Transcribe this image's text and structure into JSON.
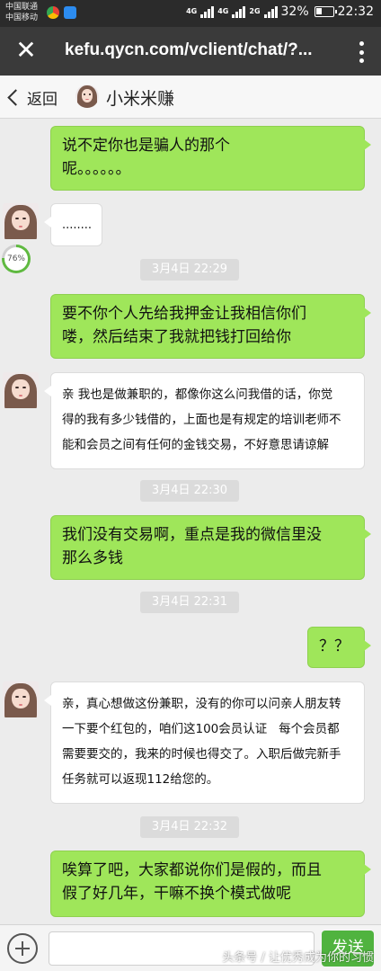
{
  "status_bar": {
    "carrier_1": "中国联通",
    "carrier_2": "中国移动",
    "net_4g": "4G",
    "net_4g_small": "4G",
    "net_2g": "2G",
    "battery": "32%",
    "time": "22:32"
  },
  "browser": {
    "url": "kefu.qycn.com/vclient/chat/?..."
  },
  "chat_header": {
    "back_label": "返回",
    "title": "小米米赚"
  },
  "messages": {
    "m1": "说不定你也是骗人的那个\n呢。。。。。。",
    "m2": "........",
    "progress_text": "76%",
    "progress_value": 0.76,
    "ts1": "3月4日 22:29",
    "m3": "要不你个人先给我押金让我相信你们\n喽，然后结束了我就把钱打回给你",
    "m4": "亲 我也是做兼职的，都像你这么问我借的话，你觉\n得的我有多少钱借的，上面也是有规定的培训老师不\n能和会员之间有任何的金钱交易，不好意思请谅解",
    "ts2": "3月4日 22:30",
    "m5": "我们没有交易啊，重点是我的微信里没\n那么多钱",
    "ts3": "3月4日 22:31",
    "m6": "？？",
    "m7": "亲，真心想做这份兼职，没有的你可以问亲人朋友转\n一下要个红包的，咱们这100会员认证   每个会员都\n需要要交的，我来的时候也得交了。入职后做完新手\n任务就可以返现112给您的。",
    "ts4": "3月4日 22:32",
    "m8": "唉算了吧，大家都说你们是假的，而且\n假了好几年，干嘛不换个模式做呢"
  },
  "input_bar": {
    "placeholder": "",
    "send_label": "发送"
  },
  "watermark": "头条号 / 让优秀成为你的习惯",
  "colors": {
    "outgoing_bubble": "#9fe65a",
    "send_button": "#50b33f",
    "browser_bar": "#3a3a3a"
  }
}
